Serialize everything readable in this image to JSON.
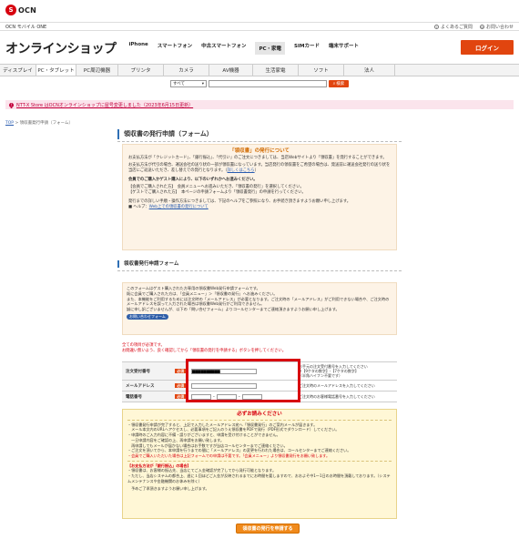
{
  "site": {
    "logo": "OCN",
    "sub_site": "OCN モバイル ONE",
    "links": [
      "よくあるご質問",
      "お問い合わせ"
    ]
  },
  "header": {
    "brand": "オンラインショップ",
    "nav": [
      "iPhone",
      "スマートフォン",
      "中古スマートフォン",
      "PC・家電",
      "SIMカード",
      "端末サポート"
    ],
    "login": "ログイン"
  },
  "categories": [
    "ディスプレイ",
    "PC・タブレット",
    "PC周辺機器",
    "プリンタ",
    "カメラ",
    "AV機器",
    "生活家電",
    "ソフト",
    "法人"
  ],
  "search": {
    "select": "すべて",
    "button": "検索",
    "button_icon": "search-icon"
  },
  "notice": "NTT-X Store はOCNオンラインショップに屋号変更しました（2023年6月15日更新）",
  "breadcrumb": {
    "top": "TOP",
    "current": "領収書発行申請（フォーム）"
  },
  "page_title": "領収書の発行申請（フォーム）",
  "info": {
    "title": "「領収書」の発行について",
    "p1": "お支払方法が「クレジットカード」、「銀行振込」、「代引い」のご注文につきましては、当店Webサイトより「領収書」を発行することができます。",
    "p2": "お支払方法が代引の場合、運送会社の送り状の一部が領収書になっています。当店発行の領収書をご希望の場合は、発送前に運送会社発行の送り状を当店にご返送いただき、差し替えでの発行となります。",
    "link1": "詳しくはこちら",
    "bold": "会員でのご購入かゲスト購入により、以下のいずれかへお進みください。",
    "member": "【会員でご購入された方】　会員メニューへお進みいただき、「領収書の発行」を選択してください。",
    "member_link": "会員メニュー",
    "guest": "【ゲストでご購入された方】　本ページの申請フォームより「領収書発行」の申請を行ってください。",
    "help_lead": "発行までの詳しい手順・操作方法につきましては、下記のヘルプをご参照になり、お手続き頂きますようお願い申し上げます。",
    "help_label": "■ ヘルプ：",
    "help_link": "Web上での領収書の発行について"
  },
  "form_title": "領収書発行申請フォーム",
  "form_desc": {
    "p1": "このフォームはゲスト購入された方専用の領収書Web発行申請フォームです。",
    "p2": "既に会員でご購入された方は、「会員メニュー」＞「領収書の発行」へお進みください。",
    "p3": "また、本機能をご利用するためには注文時の「メールアドレス」が必要となります。ご注文時の「メールアドレス」がご利用できない場合や、ご注文時のメールアドレスを誤って入力された場合は領収書Web発行がご利用できません。",
    "p4": "誠に申し訳ございませんが、以下の「問い合せフォーム」よりコールセンターまでご連絡頂きますようお願い申し上げます。",
    "button": "お問い合わせフォーム"
  },
  "required_note": "全ての項目が必須です。",
  "required_note2": "お間違い無いよう、良く確認してから「領収書の発行を申請する」ボタンを押してください。",
  "form": {
    "badge": "必須",
    "rows": [
      {
        "label": "注文受付番号",
        "value": "██████████",
        "note": "お手元の注文受付番号を入力してください\n※【9ケタの数字】-【7ケタの数字】\n（半角ハイフン不要です）"
      },
      {
        "label": "メールアドレス",
        "value": "",
        "note": "ご注文時のメールアドレスを入力してください"
      },
      {
        "label": "電話番号",
        "value": "",
        "note": "ご注文時のお客様電話番号を入力してください"
      }
    ],
    "dash": "-"
  },
  "must": {
    "title": "必ずお読みください",
    "l1": "・領収書発行申請が完了すると、上記で入力したメールアドレス宛へ「領収書発行」のご案内メールが届きます。",
    "l2": "　メール本文内のURLへアクセスし、必要事項をご記入のうえ領収書をPDFで発行（PDF形式でダウンロード）してください。",
    "l3": "・申請時のご入力内容に不備・誤りがございますと、申請を受け付けることができません。",
    "l4": "　一旦申請内容をご確認の上、再申請をお願い致します。",
    "l5": "　再申請してもメールが届かない場合はお手数ですが当店コールセンターまでご連絡ください。",
    "l6": "・ご注文を頂いてから、本申請を行うまでの間に「メールアドレス」の変更を行われた場合は、コールセンターまでご連絡ください。",
    "red": "・会員でご購入いただいた場合は上記フォームでの申請は不要です。「会員メニュー」より領収書発行をお願い致します。",
    "red_link": "会員メニュー",
    "sub": "【お支払方法が「銀行振込」の場合】",
    "s1": "・領収書は、お客様の振込先、当店にてご入金確認が完了してから発行可能となります。",
    "s2": "・ただし、当店システムの都合上、週に１回ほどご入金が反映されるまでにお時間を要しますので、おおよそ中1～1日のお時間を頂戴しております。（システムメンテナンスや金融機関のお休みを除く）",
    "thanks": "　予めご了承頂きますようお願い申し上げます。"
  },
  "submit": "領収書の発行を申請する"
}
